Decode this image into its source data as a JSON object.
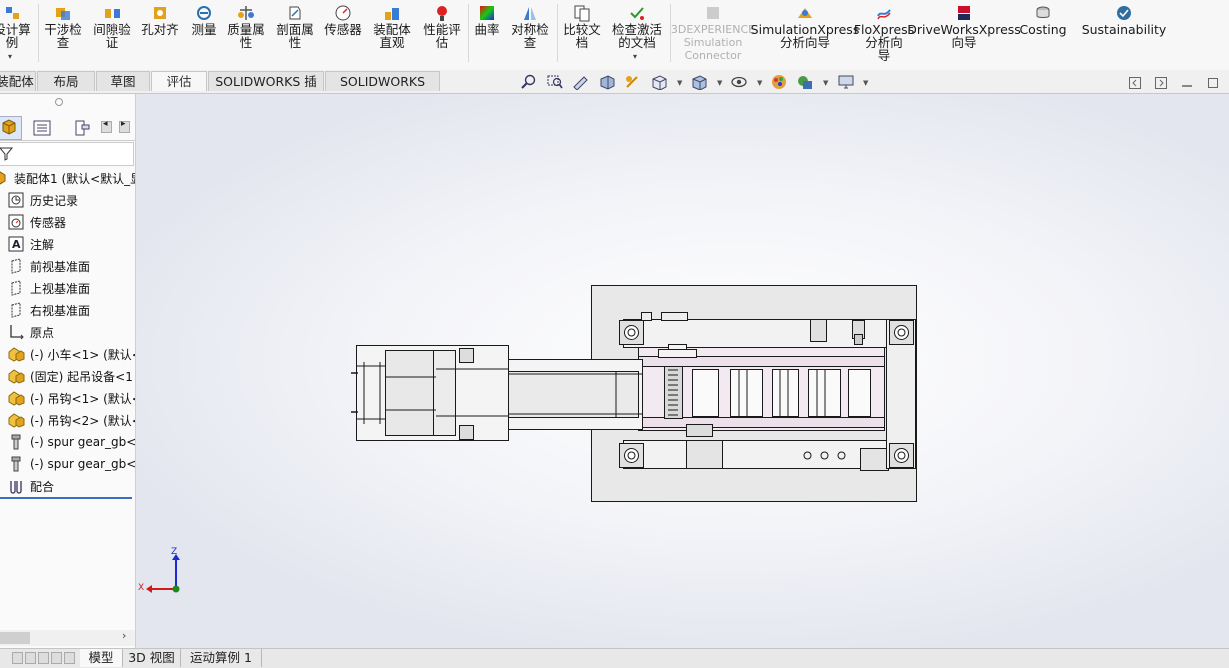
{
  "ribbon": {
    "tools": [
      {
        "label": "设计算\n例",
        "icon": "design-study-icon",
        "disabled": false
      },
      {
        "label": "干涉检\n查",
        "icon": "interference-check-icon",
        "disabled": false
      },
      {
        "label": "间隙验\n证",
        "icon": "clearance-verify-icon",
        "disabled": false
      },
      {
        "label": "孔对齐",
        "icon": "hole-alignment-icon",
        "disabled": false
      },
      {
        "label": "测量",
        "icon": "measure-icon",
        "disabled": false
      },
      {
        "label": "质量属\n性",
        "icon": "mass-properties-icon",
        "disabled": false
      },
      {
        "label": "剖面属\n性",
        "icon": "section-properties-icon",
        "disabled": false
      },
      {
        "label": "传感器",
        "icon": "sensor-icon",
        "disabled": false
      },
      {
        "label": "装配体\n直观",
        "icon": "assembly-visualization-icon",
        "disabled": false
      },
      {
        "label": "性能评\n估",
        "icon": "performance-evaluation-icon",
        "disabled": false
      },
      {
        "label": "曲率",
        "icon": "curvature-icon",
        "disabled": false
      },
      {
        "label": "对称检\n查",
        "icon": "symmetry-check-icon",
        "disabled": false
      },
      {
        "label": "比较文\n档",
        "icon": "compare-documents-icon",
        "disabled": false
      },
      {
        "label": "检查激活\n的文档",
        "icon": "check-active-document-icon",
        "disabled": false
      },
      {
        "label": "3DEXPERIENCE\nSimulation\nConnector",
        "icon": "3dexperience-icon",
        "disabled": true
      },
      {
        "label": "SimulationXpress\n分析向导",
        "icon": "simulationxpress-icon",
        "disabled": false
      },
      {
        "label": "FloXpress\n分析向\n导",
        "icon": "floxpress-icon",
        "disabled": false
      },
      {
        "label": "DriveWorksXpress\n向导",
        "icon": "driveworksxpress-icon",
        "disabled": false
      },
      {
        "label": "Costing",
        "icon": "costing-icon",
        "disabled": false
      },
      {
        "label": "Sustainability",
        "icon": "sustainability-icon",
        "disabled": false
      }
    ]
  },
  "command_tabs": [
    "装配体",
    "布局",
    "草图",
    "评估",
    "SOLIDWORKS 插件",
    "SOLIDWORKS MBD"
  ],
  "active_tab": "评估",
  "feature_tree": {
    "root": "装配体1 (默认<默认_显",
    "items": [
      {
        "label": "历史记录",
        "icon": "history-icon"
      },
      {
        "label": "传感器",
        "icon": "sensor-folder-icon"
      },
      {
        "label": "注解",
        "icon": "annotation-icon"
      },
      {
        "label": "前视基准面",
        "icon": "plane-icon"
      },
      {
        "label": "上视基准面",
        "icon": "plane-icon"
      },
      {
        "label": "右视基准面",
        "icon": "plane-icon"
      },
      {
        "label": "原点",
        "icon": "origin-icon"
      },
      {
        "label": "(-) 小车<1> (默认<",
        "icon": "part-icon"
      },
      {
        "label": "(固定) 起吊设备<1",
        "icon": "part-icon"
      },
      {
        "label": "(-) 吊钩<1> (默认<",
        "icon": "part-icon"
      },
      {
        "label": "(-) 吊钩<2> (默认<",
        "icon": "part-icon"
      },
      {
        "label": "(-) spur gear_gb<",
        "icon": "bolt-icon"
      },
      {
        "label": "(-) spur gear_gb<",
        "icon": "bolt-icon"
      },
      {
        "label": "配合",
        "icon": "mates-icon"
      }
    ]
  },
  "triad": {
    "z": "Z",
    "x": "X"
  },
  "bottom_tabs": [
    "模型",
    "3D 视图",
    "运动算例 1"
  ],
  "active_bottom_tab": "模型"
}
